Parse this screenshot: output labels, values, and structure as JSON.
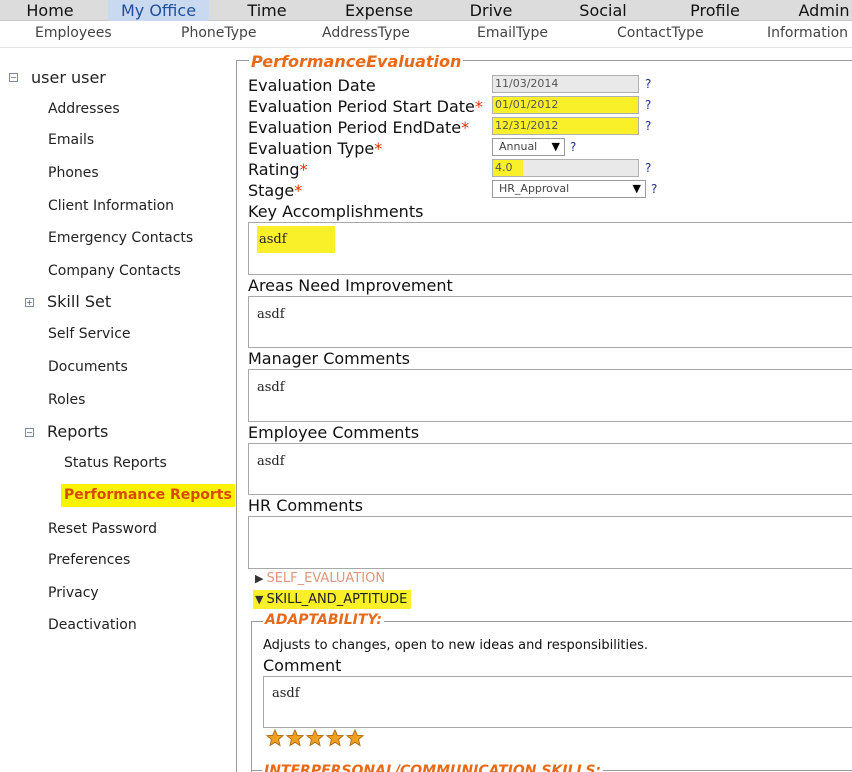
{
  "topnav": {
    "items": [
      "Home",
      "My Office",
      "Time",
      "Expense",
      "Drive",
      "Social",
      "Profile",
      "Admin"
    ],
    "active": "My Office"
  },
  "subnav": {
    "items": [
      "Employees",
      "PhoneType",
      "AddressType",
      "EmailType",
      "ContactType",
      "Information"
    ]
  },
  "sidebar": {
    "user": "user user",
    "items": {
      "addresses": "Addresses",
      "emails": "Emails",
      "phones": "Phones",
      "client_info": "Client Information",
      "emergency": "Emergency Contacts",
      "company": "Company Contacts",
      "skill_set": "Skill Set",
      "self_service": "Self Service",
      "documents": "Documents",
      "roles": "Roles",
      "reports": "Reports",
      "status_reports": "Status Reports",
      "performance_reports": "Performance Reports",
      "reset_password": "Reset Password",
      "preferences": "Preferences",
      "privacy": "Privacy",
      "deactivation": "Deactivation"
    },
    "expand_icon": "⊟",
    "collapse_icon": "⊞"
  },
  "form": {
    "legend": "PerformanceEvaluation",
    "help": "?",
    "required_mark": "*",
    "eval_date": {
      "label": "Evaluation Date",
      "value": "11/03/2014"
    },
    "period_start": {
      "label": "Evaluation Period Start Date",
      "value": "01/01/2012"
    },
    "period_end": {
      "label": "Evaluation Period EndDate",
      "value": "12/31/2012"
    },
    "eval_type": {
      "label": "Evaluation Type",
      "value": "Annual"
    },
    "rating": {
      "label": "Rating",
      "value": "4.0"
    },
    "stage": {
      "label": "Stage",
      "value": "HR_Approval"
    },
    "key_accomplishments": {
      "label": "Key Accomplishments",
      "value": "asdf"
    },
    "areas_improvement": {
      "label": "Areas Need Improvement",
      "value": "asdf"
    },
    "manager_comments": {
      "label": "Manager Comments",
      "value": "asdf"
    },
    "employee_comments": {
      "label": "Employee Comments",
      "value": "asdf"
    },
    "hr_comments": {
      "label": "HR Comments",
      "value": ""
    },
    "self_evaluation": "SELF_EVALUATION",
    "skill_aptitude": "SKILL_AND_APTITUDE",
    "adaptability": {
      "legend": "ADAPTABILITY:",
      "description": "Adjusts to changes, open to new ideas and responsibilities.",
      "comment_label": "Comment",
      "comment": "asdf",
      "rating_stars": 5
    },
    "next_section": "INTERPERSONAL/COMMUNICATION SKILLS:"
  },
  "colors": {
    "accent_orange": "#e86a18",
    "highlight_yellow": "#f9f02a",
    "nav_active": "#c9daf0"
  }
}
